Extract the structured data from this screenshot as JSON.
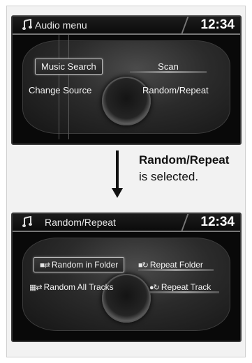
{
  "top_screen": {
    "title": "Audio menu",
    "clock": "12:34",
    "items": [
      {
        "label": "Music Search"
      },
      {
        "label": "Scan"
      },
      {
        "label": "Change Source"
      },
      {
        "label": "Random/Repeat"
      }
    ]
  },
  "transition": {
    "emphasis": "Random/Repeat",
    "text": "is selected."
  },
  "bottom_screen": {
    "title": "Random/Repeat",
    "clock": "12:34",
    "items": [
      {
        "label": "Random in Folder",
        "icon": "random-folder-icon"
      },
      {
        "label": "Repeat Folder",
        "icon": "repeat-folder-icon"
      },
      {
        "label": "Random All Tracks",
        "icon": "random-all-icon"
      },
      {
        "label": "Repeat Track",
        "icon": "repeat-track-icon"
      }
    ]
  },
  "colors": {
    "screen_bg": "#090909",
    "text": "#f4f4f4"
  }
}
